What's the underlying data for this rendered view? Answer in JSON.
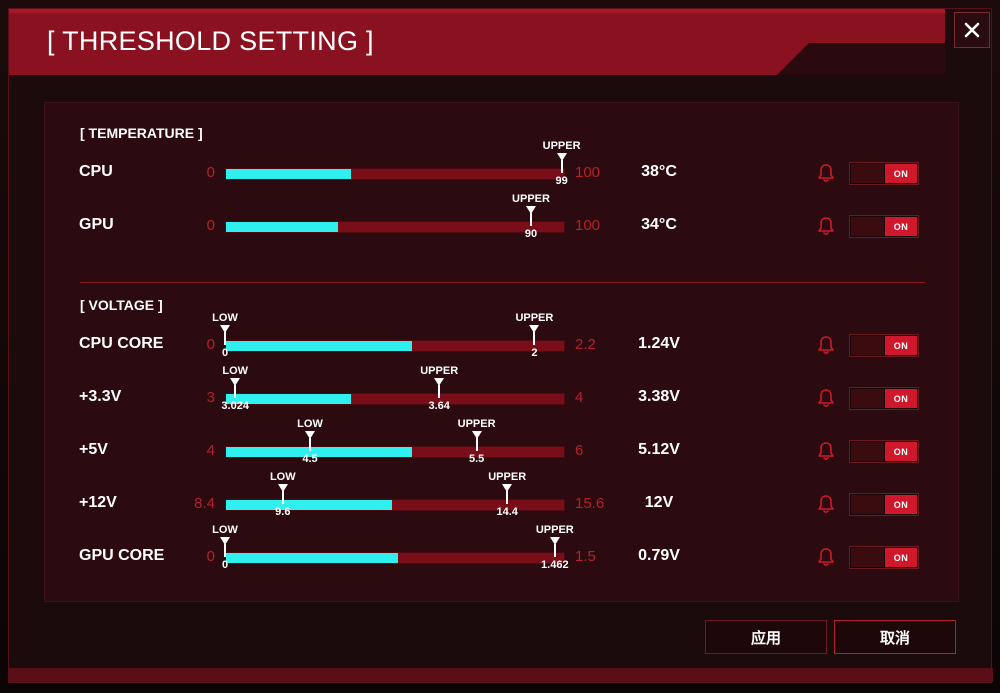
{
  "title": "[ THRESHOLD SETTING ]",
  "close_label": "✕",
  "temperature": {
    "section_title": "[ TEMPERATURE ]",
    "rows": [
      {
        "name": "CPU",
        "min": "0",
        "max": "100",
        "fill": 0.37,
        "current": "38°C",
        "upper": {
          "label": "UPPER",
          "value": "99",
          "pos": 0.99
        },
        "alert_on": "ON"
      },
      {
        "name": "GPU",
        "min": "0",
        "max": "100",
        "fill": 0.33,
        "current": "34°C",
        "upper": {
          "label": "UPPER",
          "value": "90",
          "pos": 0.9
        },
        "alert_on": "ON"
      }
    ]
  },
  "voltage": {
    "section_title": "[ VOLTAGE ]",
    "rows": [
      {
        "name": "CPU CORE",
        "min": "0",
        "max": "2.2",
        "fill": 0.55,
        "current": "1.24V",
        "low": {
          "label": "LOW",
          "value": "0",
          "pos": 0.0
        },
        "upper": {
          "label": "UPPER",
          "value": "2",
          "pos": 0.91
        },
        "alert_on": "ON"
      },
      {
        "name": "+3.3V",
        "min": "3",
        "max": "4",
        "fill": 0.37,
        "current": "3.38V",
        "low": {
          "label": "LOW",
          "value": "3.024",
          "pos": 0.03
        },
        "upper": {
          "label": "UPPER",
          "value": "3.64",
          "pos": 0.63
        },
        "alert_on": "ON"
      },
      {
        "name": "+5V",
        "min": "4",
        "max": "6",
        "fill": 0.55,
        "current": "5.12V",
        "low": {
          "label": "LOW",
          "value": "4.5",
          "pos": 0.25
        },
        "upper": {
          "label": "UPPER",
          "value": "5.5",
          "pos": 0.74
        },
        "alert_on": "ON"
      },
      {
        "name": "+12V",
        "min": "8.4",
        "max": "15.6",
        "fill": 0.49,
        "current": "12V",
        "low": {
          "label": "LOW",
          "value": "9.6",
          "pos": 0.17
        },
        "upper": {
          "label": "UPPER",
          "value": "14.4",
          "pos": 0.83
        },
        "alert_on": "ON"
      },
      {
        "name": "GPU CORE",
        "min": "0",
        "max": "1.5",
        "fill": 0.51,
        "current": "0.79V",
        "low": {
          "label": "LOW",
          "value": "0",
          "pos": 0.0
        },
        "upper": {
          "label": "UPPER",
          "value": "1.462",
          "pos": 0.97
        },
        "alert_on": "ON"
      }
    ]
  },
  "buttons": {
    "apply": "应用",
    "cancel": "取消"
  },
  "colors": {
    "accent": "#d0182c",
    "fill": "#2ff0ee",
    "track": "#7a0e18",
    "range_text": "#b5202e"
  }
}
